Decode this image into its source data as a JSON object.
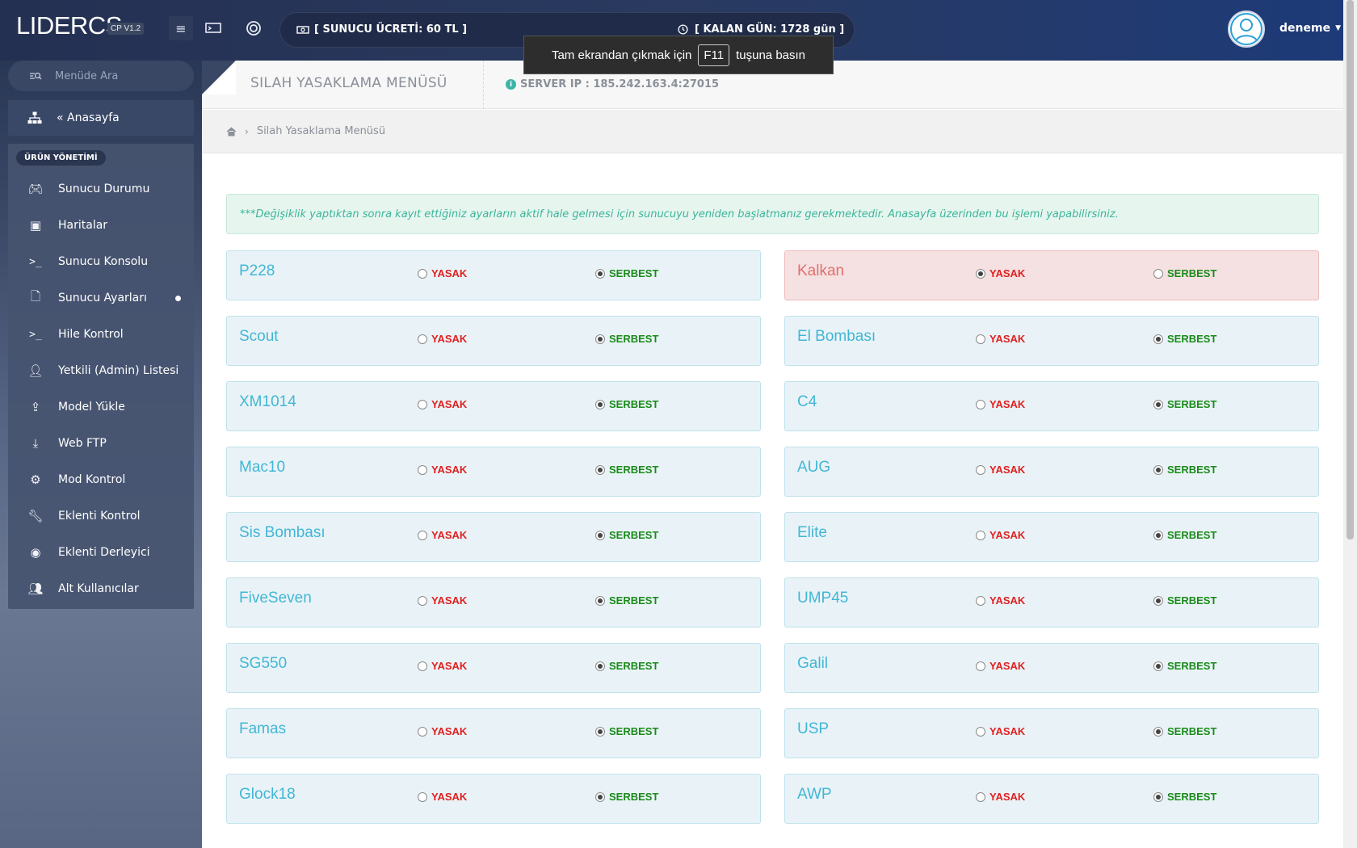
{
  "app": {
    "logo": "LIDERCS",
    "version": "CP V1.2"
  },
  "topbar": {
    "fee": "[ SUNUCU ÜCRETİ: 60 TL ]",
    "days": "[ KALAN GÜN: 1728 gün ]",
    "username": "deneme"
  },
  "fullscreen_tip": {
    "before": "Tam ekrandan çıkmak için",
    "key": "F11",
    "after": "tuşuna basın"
  },
  "sidebar": {
    "search_placeholder": "Menüde Ara",
    "home": "« Anasayfa",
    "section": "ÜRÜN YÖNETİMİ",
    "items": [
      {
        "label": "Sunucu Durumu",
        "icon": "gamepad-icon"
      },
      {
        "label": "Haritalar",
        "icon": "inbox-icon"
      },
      {
        "label": "Sunucu Konsolu",
        "icon": "terminal-icon"
      },
      {
        "label": "Sunucu Ayarları",
        "icon": "file-icon"
      },
      {
        "label": "Hile Kontrol",
        "icon": "terminal-icon"
      },
      {
        "label": "Yetkili (Admin) Listesi",
        "icon": "user-plus-icon"
      },
      {
        "label": "Model Yükle",
        "icon": "upload-icon"
      },
      {
        "label": "Web FTP",
        "icon": "download-icon"
      },
      {
        "label": "Mod Kontrol",
        "icon": "gear-icon"
      },
      {
        "label": "Eklenti Kontrol",
        "icon": "wrench-icon"
      },
      {
        "label": "Eklenti Derleyici",
        "icon": "eye-icon"
      },
      {
        "label": "Alt Kullanıcılar",
        "icon": "users-icon"
      }
    ]
  },
  "page": {
    "title": "SILAH YASAKLAMA MENÜSÜ",
    "server_ip": "SERVER IP : 185.242.163.4:27015",
    "breadcrumb": "Silah Yasaklama Menüsü",
    "notice": "***Değişiklik yaptıktan sonra kayıt ettiğiniz ayarların aktif hale gelmesi için sunucuyu yeniden başlatmanız gerekmektedir. Anasayfa üzerinden bu işlemi yapabilirsiniz.",
    "yasak_label": "YASAK",
    "serbest_label": "SERBEST"
  },
  "weapons": [
    {
      "name": "P228",
      "state": "serbest"
    },
    {
      "name": "Kalkan",
      "state": "yasak"
    },
    {
      "name": "Scout",
      "state": "serbest"
    },
    {
      "name": "El Bombası",
      "state": "serbest"
    },
    {
      "name": "XM1014",
      "state": "serbest"
    },
    {
      "name": "C4",
      "state": "serbest"
    },
    {
      "name": "Mac10",
      "state": "serbest"
    },
    {
      "name": "AUG",
      "state": "serbest"
    },
    {
      "name": "Sis Bombası",
      "state": "serbest"
    },
    {
      "name": "Elite",
      "state": "serbest"
    },
    {
      "name": "FiveSeven",
      "state": "serbest"
    },
    {
      "name": "UMP45",
      "state": "serbest"
    },
    {
      "name": "SG550",
      "state": "serbest"
    },
    {
      "name": "Galil",
      "state": "serbest"
    },
    {
      "name": "Famas",
      "state": "serbest"
    },
    {
      "name": "USP",
      "state": "serbest"
    },
    {
      "name": "Glock18",
      "state": "serbest"
    },
    {
      "name": "AWP",
      "state": "serbest"
    }
  ]
}
